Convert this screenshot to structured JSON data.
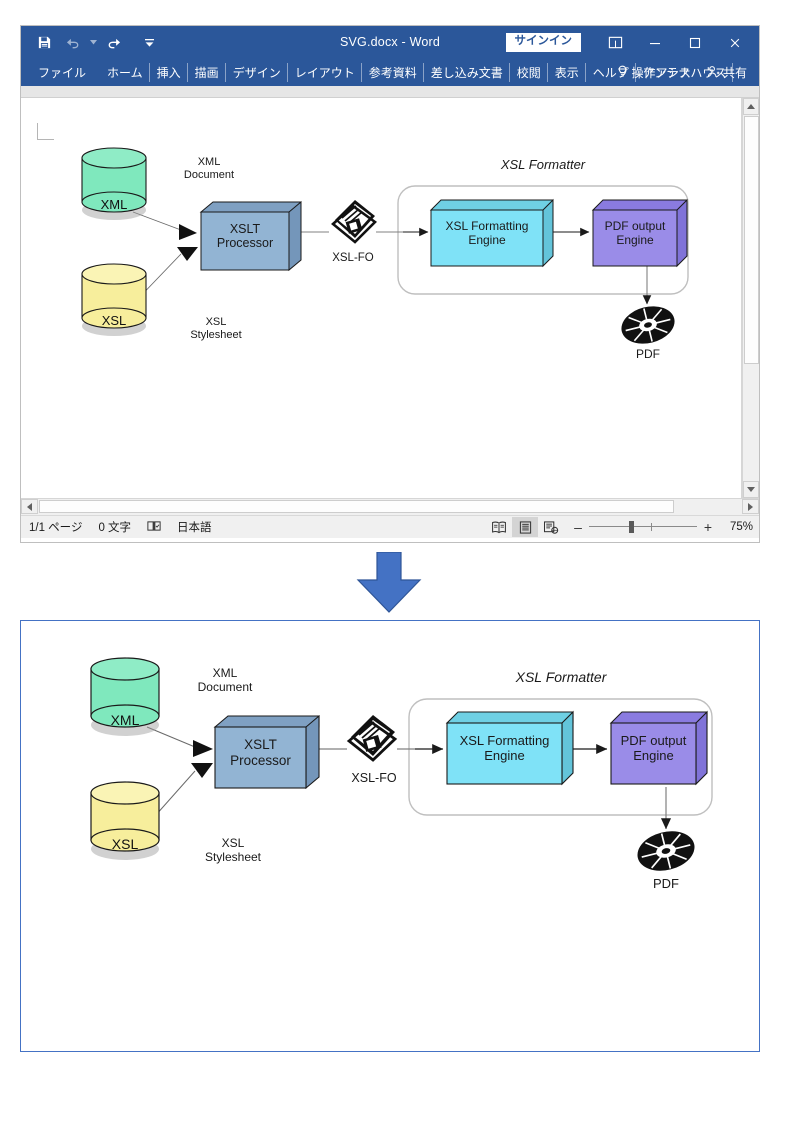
{
  "window": {
    "title": "SVG.docx  -  Word",
    "quick_access": [
      {
        "name": "save-icon",
        "label": "保存"
      },
      {
        "name": "undo-icon",
        "label": "元に戻す"
      },
      {
        "name": "redo-icon",
        "label": "やり直し"
      },
      {
        "name": "customize-qat-icon",
        "label": "クイック アクセス ツール バーのユーザー設定"
      }
    ],
    "signin_label": "サインイン",
    "ribbon_display_options_icon": "ribbon-display-options-icon",
    "minimize_label": "—",
    "maximize_label": "□",
    "close_label": "✕"
  },
  "ribbon": {
    "tabs": [
      "ファイル",
      "ホーム",
      "挿入",
      "描画",
      "デザイン",
      "レイアウト",
      "参考資料",
      "差し込み文書",
      "校閲",
      "表示",
      "ヘルプ",
      "アンテナハウス"
    ],
    "tell_me": "操作アシス",
    "share": "共有"
  },
  "status_bar": {
    "page": "1/1 ページ",
    "words": "0 文字",
    "proofing_icon": "proofing-errors-icon",
    "language": "日本語",
    "views": [
      {
        "name": "read-mode-view",
        "label": "閲覧モード"
      },
      {
        "name": "print-layout-view",
        "label": "印刷レイアウト",
        "active": true
      },
      {
        "name": "web-layout-view",
        "label": "Web レイアウト"
      }
    ],
    "zoom_out": "–",
    "zoom_in": "+",
    "zoom_level": "75%"
  },
  "diagram": {
    "title": "XSL Formatter",
    "nodes": {
      "xml_cylinder": "XML",
      "xml_caption": "XML\nDocument",
      "xsl_cylinder": "XSL",
      "xsl_caption": "XSL\nStylesheet",
      "xslt_processor": "XSLT\nProcessor",
      "xslfo_caption": "XSL-FO",
      "formatting_engine": "XSL Formatting\nEngine",
      "pdf_engine": "PDF output\nEngine",
      "pdf_caption": "PDF"
    },
    "colors": {
      "xml_cylinder": "#7fe8bd",
      "xsl_cylinder": "#f7ee9c",
      "xslt_processor": "#92b4d3",
      "formatting_engine": "#7fe2f7",
      "pdf_engine": "#9a8ce8",
      "container_border": "#bfbfbf",
      "shadow": "#a8a8a8",
      "stroke": "#1a1a1a"
    },
    "icons": {
      "floppy": "floppy-disk-icon",
      "cd": "cd-disc-icon"
    }
  },
  "transition": {
    "arrow_icon": "down-arrow-icon",
    "arrow_color": "#4472c4"
  }
}
